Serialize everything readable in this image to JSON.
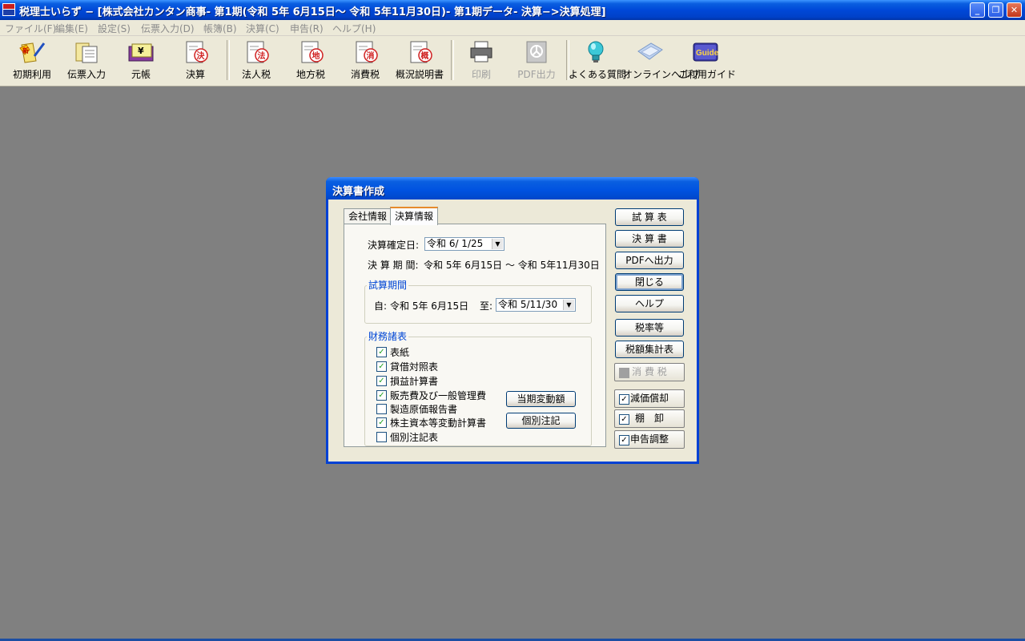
{
  "window": {
    "title": "税理士いらず − [株式会社カンタン商事- 第1期(令和 5年 6月15日～ 令和 5年11月30日)- 第1期データ- 決算−>決算処理]",
    "minimize_label": "_",
    "restore_label": "❐",
    "close_label": "✕"
  },
  "menu": {
    "items": [
      {
        "label": "ファイル(F)"
      },
      {
        "label": "編集(E)"
      },
      {
        "label": "設定(S)"
      },
      {
        "label": "伝票入力(D)"
      },
      {
        "label": "帳簿(B)"
      },
      {
        "label": "決算(C)"
      },
      {
        "label": "申告(R)"
      },
      {
        "label": "ヘルプ(H)"
      }
    ]
  },
  "toolbar": {
    "buttons": [
      {
        "label": "初期利用",
        "icon": "new-start-icon",
        "enabled": true
      },
      {
        "label": "伝票入力",
        "icon": "voucher-icon",
        "enabled": true
      },
      {
        "label": "元帳",
        "icon": "ledger-icon",
        "enabled": true
      },
      {
        "label": "決算",
        "icon": "settlement-icon",
        "enabled": true
      },
      {
        "label": "法人税",
        "icon": "corporate-tax-icon",
        "enabled": true
      },
      {
        "label": "地方税",
        "icon": "local-tax-icon",
        "enabled": true
      },
      {
        "label": "消費税",
        "icon": "consumption-tax-icon",
        "enabled": true
      },
      {
        "label": "概況説明書",
        "icon": "overview-doc-icon",
        "enabled": true
      },
      {
        "label": "印刷",
        "icon": "printer-icon",
        "enabled": false
      },
      {
        "label": "PDF出力",
        "icon": "pdf-icon",
        "enabled": false
      },
      {
        "label": "よくある質問",
        "icon": "faq-bulb-icon",
        "enabled": true
      },
      {
        "label": "オンラインヘルプ",
        "icon": "online-help-icon",
        "enabled": true
      },
      {
        "label": "ご利用ガイド",
        "icon": "guide-icon",
        "enabled": true
      }
    ],
    "guide_icon_text": "Guide",
    "icon_glyphs": {
      "hou": "法",
      "chi": "地",
      "shou": "消",
      "gai": "概",
      "ketsu": "決",
      "shin": "新",
      "yen": "¥"
    }
  },
  "dialog": {
    "title": "決算書作成",
    "tabs": [
      {
        "label": "会社情報",
        "active": false
      },
      {
        "label": "決算情報",
        "active": true
      }
    ],
    "kessan_kakutei_label": "決算確定日:",
    "kessan_kakutei_value": "令和 6/ 1/25",
    "kessan_kikan_label": "決 算 期 間:",
    "kessan_kikan_value": "令和 5年 6月15日 〜 令和 5年11月30日",
    "shisan_group_label": "試算期間",
    "from_label": "自:",
    "from_value": "令和 5年 6月15日",
    "to_label": "至:",
    "to_value": "令和 5/11/30",
    "zaimu_group_label": "財務諸表",
    "statements": [
      {
        "label": "表紙",
        "checked": true
      },
      {
        "label": "貸借対照表",
        "checked": true
      },
      {
        "label": "損益計算書",
        "checked": true
      },
      {
        "label": "販売費及び一般管理費",
        "checked": true
      },
      {
        "label": "製造原価報告書",
        "checked": false
      },
      {
        "label": "株主資本等変動計算書",
        "checked": true
      },
      {
        "label": "個別注記表",
        "checked": false
      }
    ],
    "touki_hendougaku_label": "当期変動額",
    "kobetsu_chuki_label": "個別注記",
    "side_buttons": [
      {
        "label": "試 算 表",
        "enabled": true
      },
      {
        "label": "決 算 書",
        "enabled": true
      },
      {
        "label": "PDFへ出力",
        "enabled": true
      },
      {
        "label": "閉じる",
        "enabled": true
      },
      {
        "label": "ヘルプ",
        "enabled": true
      },
      {
        "label": "税率等",
        "enabled": true
      },
      {
        "label": "税額集計表",
        "enabled": true
      }
    ],
    "check_buttons": [
      {
        "label": "消 費 税",
        "checked": false,
        "enabled": false
      },
      {
        "label": "減価償却",
        "checked": true,
        "enabled": true
      },
      {
        "label": "棚　卸",
        "checked": true,
        "enabled": true
      },
      {
        "label": "申告調整",
        "checked": true,
        "enabled": true
      }
    ],
    "check_mark": "✓"
  }
}
